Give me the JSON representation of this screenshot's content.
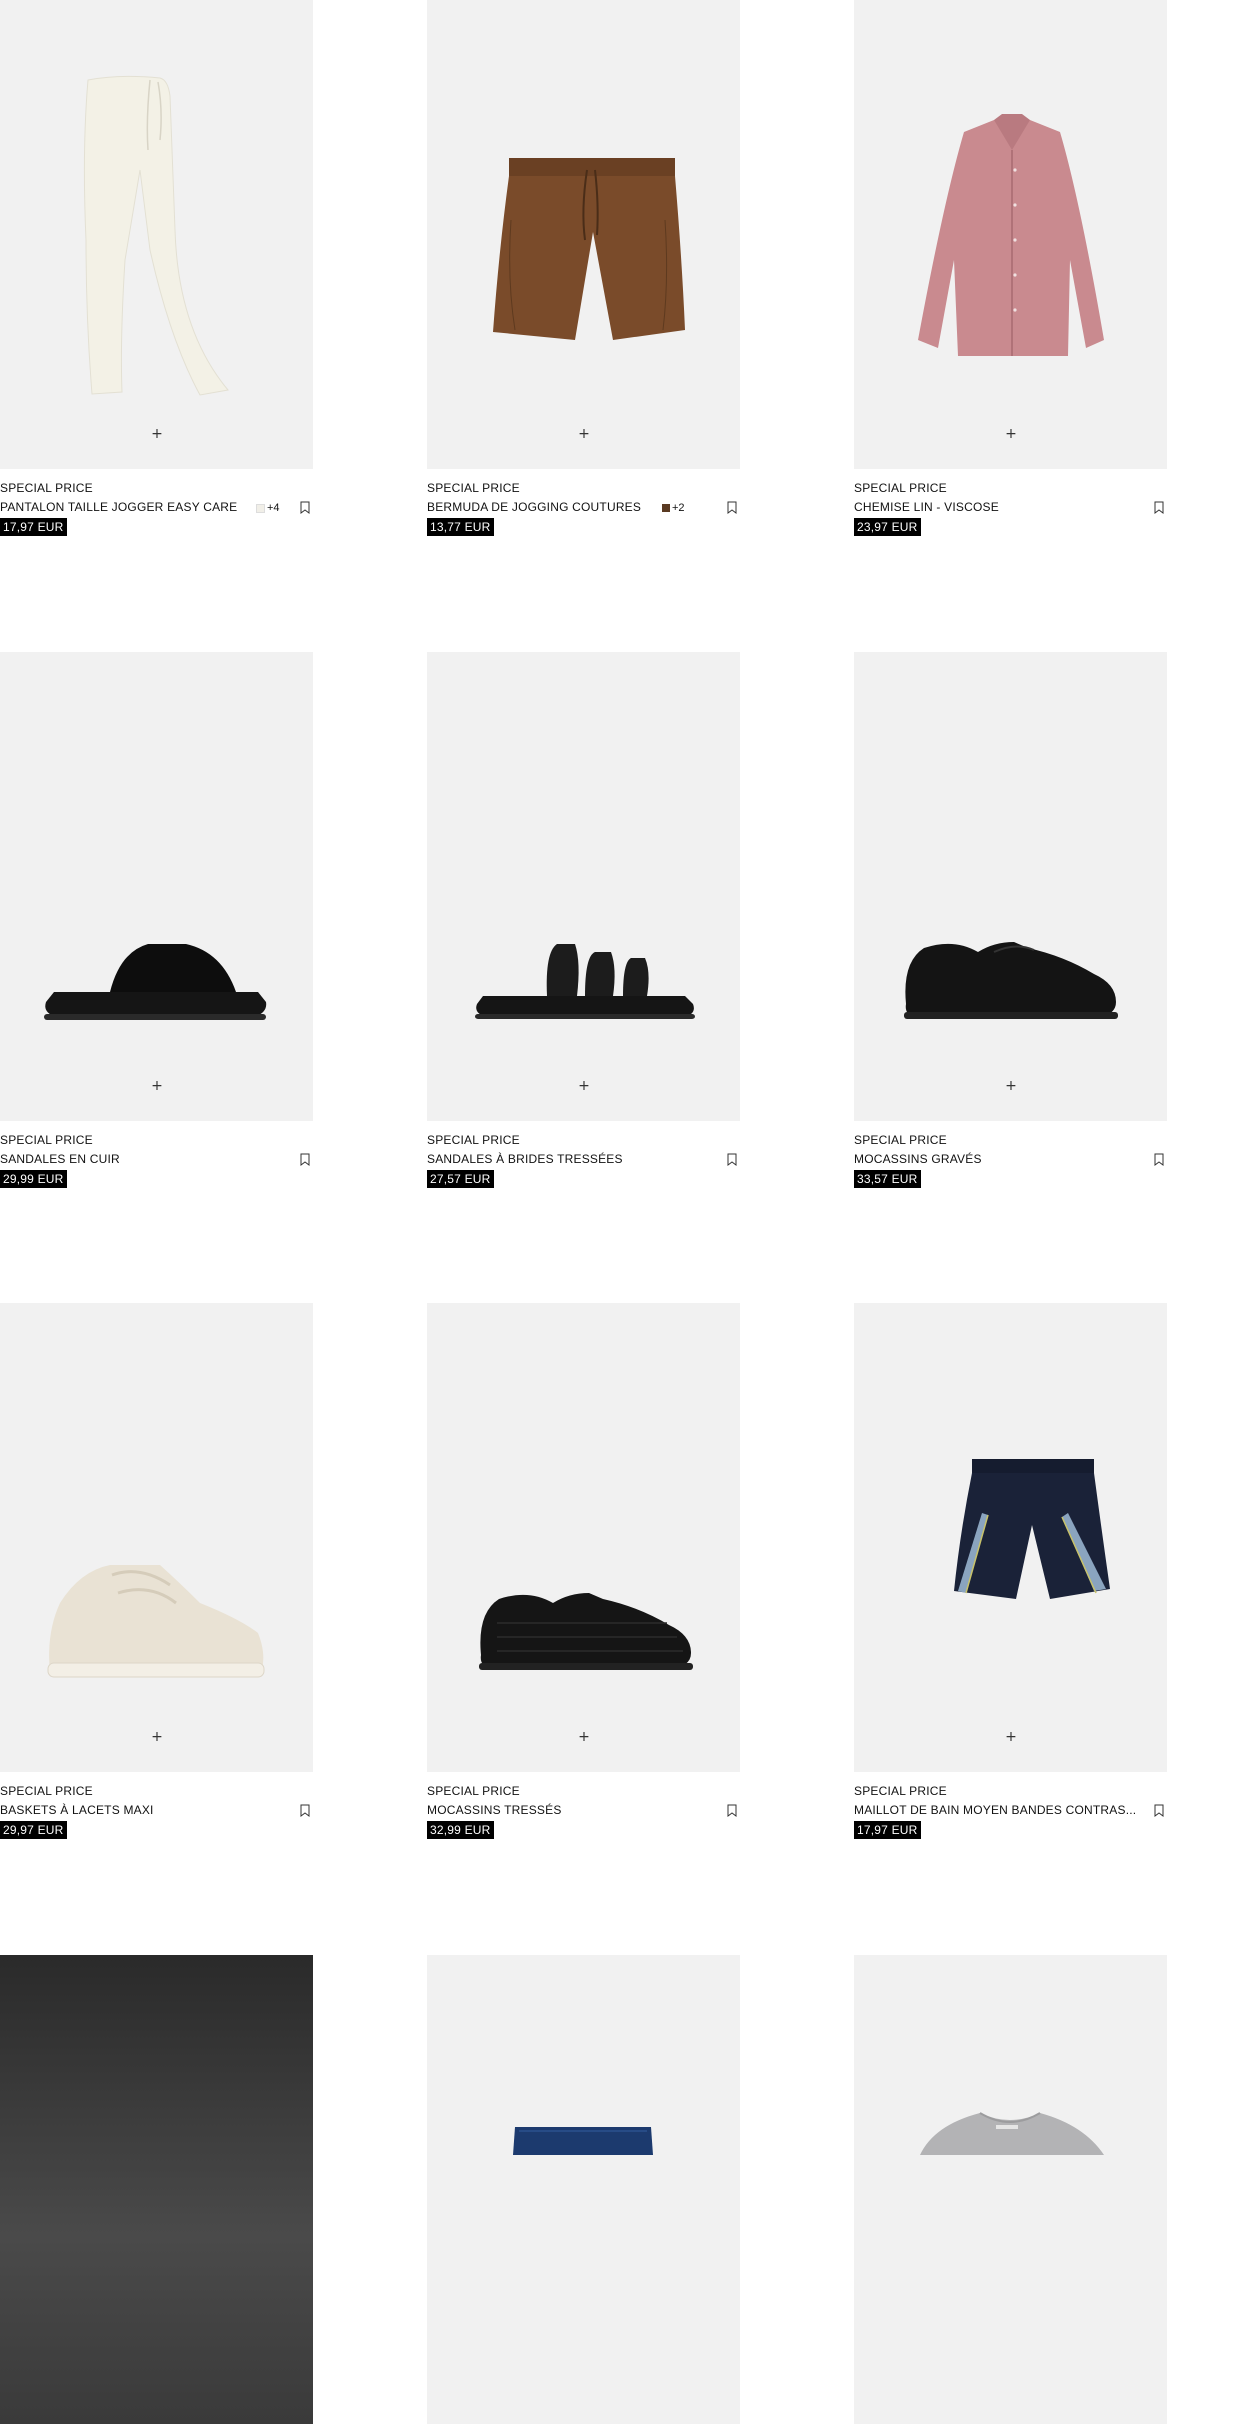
{
  "products": [
    {
      "tag": "SPECIAL PRICE",
      "name": "PANTALON TAILLE JOGGER EASY CARE",
      "swatch_color": "#f1efe8",
      "more_colors": "+4",
      "price": "17,97 EUR",
      "icon": "jogger-pants"
    },
    {
      "tag": "SPECIAL PRICE",
      "name": "BERMUDA DE JOGGING COUTURES",
      "swatch_color": "#5a3a22",
      "more_colors": "+2",
      "price": "13,77 EUR",
      "icon": "brown-shorts"
    },
    {
      "tag": "SPECIAL PRICE",
      "name": "CHEMISE LIN - VISCOSE",
      "swatch_color": "",
      "more_colors": "",
      "price": "23,97 EUR",
      "icon": "pink-shirt"
    },
    {
      "tag": "SPECIAL PRICE",
      "name": "SANDALES EN CUIR",
      "swatch_color": "",
      "more_colors": "",
      "price": "29,99 EUR",
      "icon": "leather-slide-sandal"
    },
    {
      "tag": "SPECIAL PRICE",
      "name": "SANDALES À BRIDES TRESSÉES",
      "swatch_color": "",
      "more_colors": "",
      "price": "27,57 EUR",
      "icon": "braided-strap-sandal"
    },
    {
      "tag": "SPECIAL PRICE",
      "name": "MOCASSINS GRAVÉS",
      "swatch_color": "",
      "more_colors": "",
      "price": "33,57 EUR",
      "icon": "embossed-loafer"
    },
    {
      "tag": "SPECIAL PRICE",
      "name": "BASKETS À LACETS MAXI",
      "swatch_color": "",
      "more_colors": "",
      "price": "29,97 EUR",
      "icon": "chunky-sneaker"
    },
    {
      "tag": "SPECIAL PRICE",
      "name": "MOCASSINS TRESSÉS",
      "swatch_color": "",
      "more_colors": "",
      "price": "32,99 EUR",
      "icon": "woven-loafer"
    },
    {
      "tag": "SPECIAL PRICE",
      "name": "MAILLOT DE BAIN MOYEN BANDES CONTRAS...",
      "swatch_color": "",
      "more_colors": "",
      "price": "17,97 EUR",
      "icon": "swim-shorts"
    }
  ],
  "partial_row": [
    {
      "icon": "dark-product-image"
    },
    {
      "icon": "navy-shorts"
    },
    {
      "icon": "grey-tshirt"
    }
  ],
  "ui": {
    "add_icon": "+",
    "colors": {
      "image_bg": "#f1f1f1",
      "price_bg": "#000000",
      "price_text": "#ffffff"
    }
  }
}
